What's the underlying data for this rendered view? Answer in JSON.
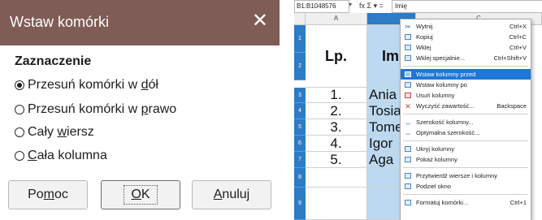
{
  "dialog": {
    "title": "Wstaw komórki",
    "section": "Zaznaczenie",
    "options": [
      {
        "pre": "Przesuń komórki w ",
        "u": "d",
        "post": "ół",
        "checked": true
      },
      {
        "pre": "Przesuń komórki w ",
        "u": "p",
        "post": "rawo",
        "checked": false
      },
      {
        "pre": "Cały ",
        "u": "w",
        "post": "iersz",
        "checked": false
      },
      {
        "pre": "",
        "u": "C",
        "post": "ała kolumna",
        "checked": false
      }
    ],
    "buttons": {
      "help": {
        "pre": "Po",
        "u": "m",
        "post": "oc"
      },
      "ok": {
        "pre": "",
        "u": "O",
        "post": "K"
      },
      "cancel": {
        "pre": "",
        "u": "A",
        "post": "nuluj"
      }
    }
  },
  "sheet": {
    "name_box": "B1:B1048576",
    "formula_icons": "fx Σ ▾ =",
    "formula_value": "Imię",
    "col_a": "A",
    "col_c": "C",
    "row_numbers": [
      "1",
      "2",
      "3",
      "4",
      "5",
      "6",
      "7",
      "8",
      "9"
    ],
    "header_lp": "Lp.",
    "header_b": "Imię",
    "rows": [
      {
        "lp": "1.",
        "name": "Ania"
      },
      {
        "lp": "2.",
        "name": "Tosia"
      },
      {
        "lp": "3.",
        "name": "Tomek"
      },
      {
        "lp": "4.",
        "name": "Igor"
      },
      {
        "lp": "5.",
        "name": "Aga"
      }
    ]
  },
  "context_menu": {
    "items": [
      {
        "label": "Wytnij",
        "shortcut": "Ctrl+X"
      },
      {
        "label": "Kopiuj",
        "shortcut": "Ctrl+C"
      },
      {
        "label": "Wklej",
        "shortcut": "Ctrl+V"
      },
      {
        "label": "Wklej specjalnie...",
        "shortcut": "Ctrl+Shift+V"
      },
      {
        "label": "Wstaw kolumny przed",
        "shortcut": ""
      },
      {
        "label": "Wstaw kolumny po",
        "shortcut": ""
      },
      {
        "label": "Usuń kolumny",
        "shortcut": ""
      },
      {
        "label": "Wyczyść zawartość...",
        "shortcut": "Backspace"
      },
      {
        "label": "Szerokość kolumny...",
        "shortcut": ""
      },
      {
        "label": "Optymalna szerokość...",
        "shortcut": ""
      },
      {
        "label": "Ukryj kolumny",
        "shortcut": ""
      },
      {
        "label": "Pokaż kolumny",
        "shortcut": ""
      },
      {
        "label": "Przytwierdź wiersze i kolumny",
        "shortcut": ""
      },
      {
        "label": "Podziel okno",
        "shortcut": ""
      },
      {
        "label": "Formatuj komórki...",
        "shortcut": "Ctrl+1"
      }
    ]
  },
  "colors": {
    "titlebar": "#7f5c55",
    "rowhead": "#2e7bc6",
    "selection": "#bcd9f1",
    "menu_highlight": "#1f77d6"
  }
}
